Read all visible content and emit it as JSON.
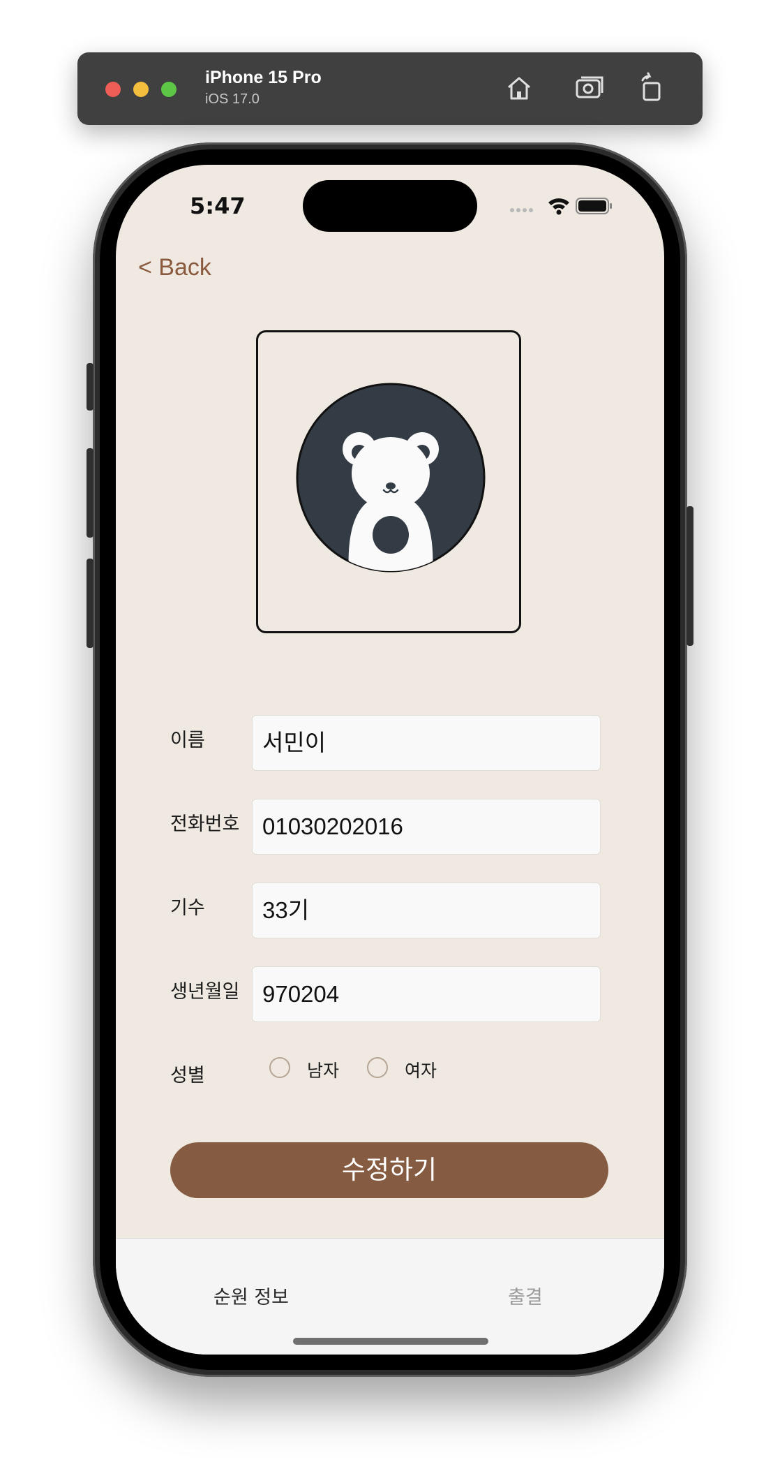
{
  "simulator": {
    "device_name": "iPhone 15 Pro",
    "os_version": "iOS 17.0",
    "icons": [
      "home-icon",
      "screenshot-icon",
      "rotate-icon"
    ]
  },
  "status_bar": {
    "time": "5:47"
  },
  "nav": {
    "back_label": "< Back"
  },
  "form": {
    "name": {
      "label": "이름",
      "value": "서민이"
    },
    "phone": {
      "label": "전화번호",
      "value": "01030202016"
    },
    "generation": {
      "label": "기수",
      "value": "33기"
    },
    "birthdate": {
      "label": "생년월일",
      "value": "970204"
    },
    "gender": {
      "label": "성별",
      "options": [
        {
          "label": "남자",
          "selected": false
        },
        {
          "label": "여자",
          "selected": false
        }
      ]
    },
    "submit_label": "수정하기"
  },
  "tabs": [
    {
      "label": "순원 정보",
      "active": true
    },
    {
      "label": "출결",
      "active": false
    }
  ],
  "colors": {
    "background": "#efe9e2",
    "accent": "#855b42",
    "back_link": "#8a5a3e",
    "avatar_bg": "#333b44"
  }
}
